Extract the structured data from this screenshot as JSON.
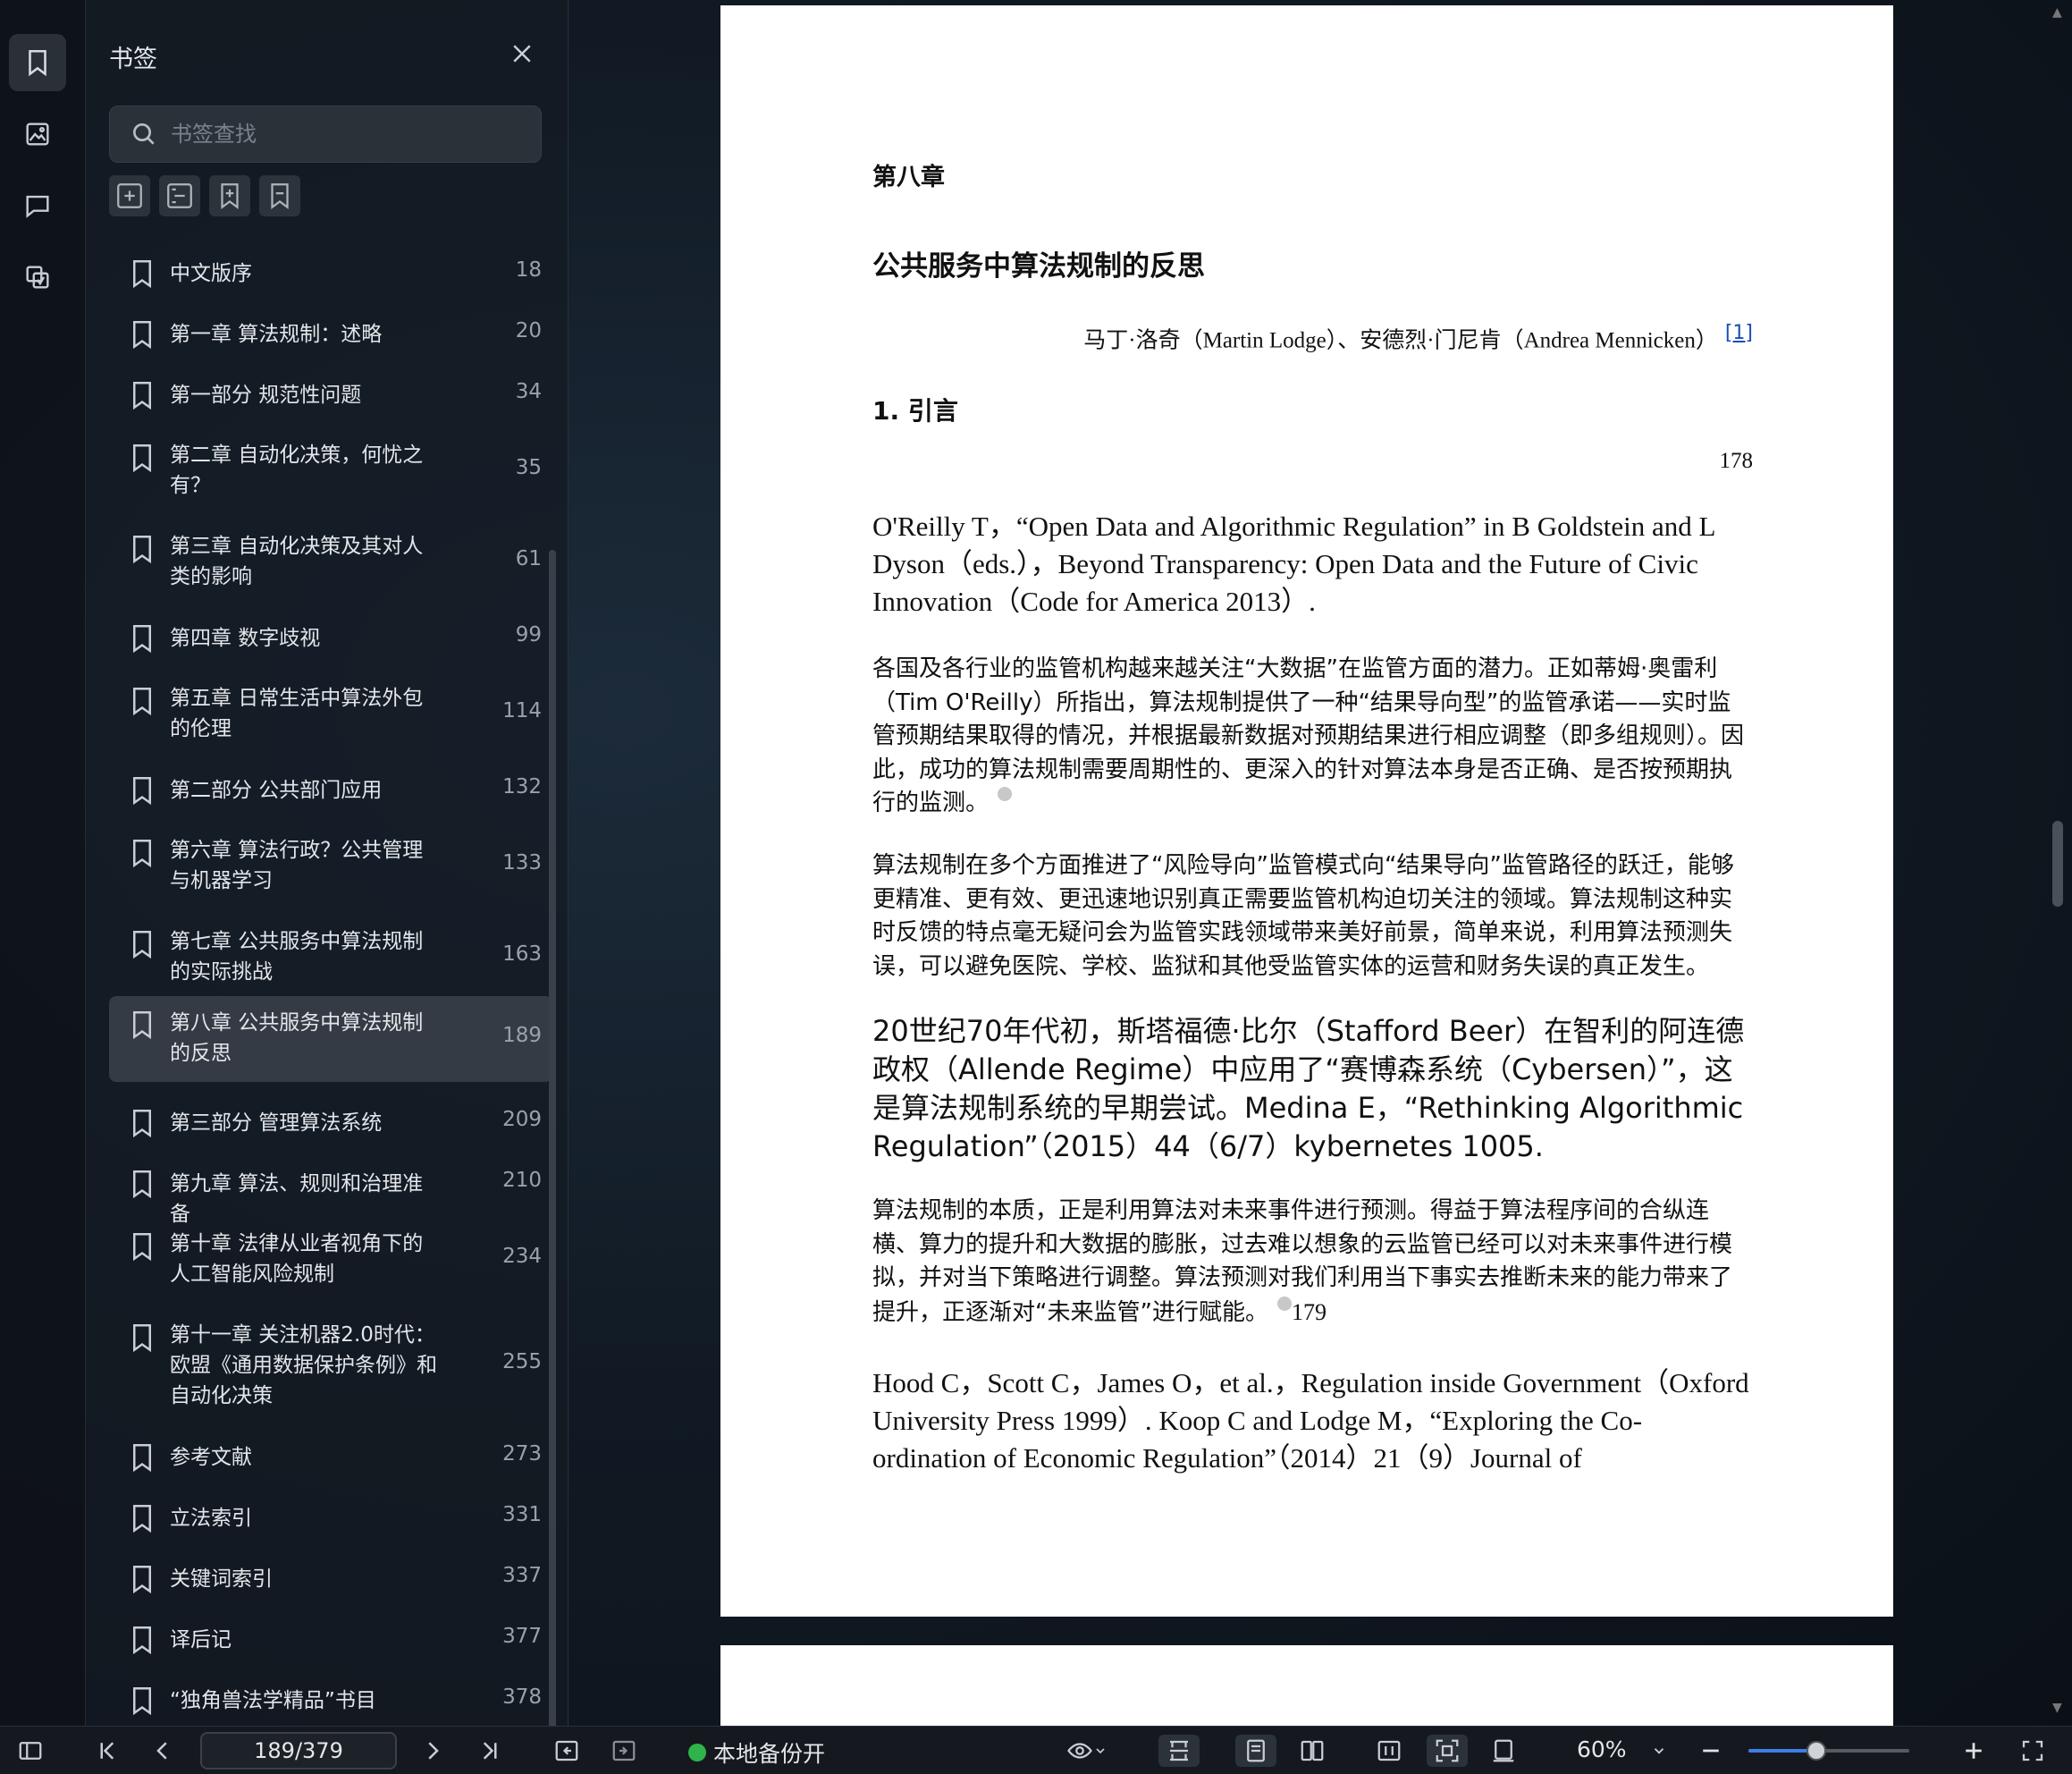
{
  "panel": {
    "title": "书签",
    "search_placeholder": "书签查找"
  },
  "bookmarks": [
    {
      "label": "中文版序",
      "page": "18"
    },
    {
      "label": "第一章 算法规制：述略",
      "page": "20"
    },
    {
      "label": "第一部分 规范性问题",
      "page": "34"
    },
    {
      "label": "第二章 自动化决策，何忧之有？",
      "page": "35"
    },
    {
      "label": "第三章 自动化决策及其对人类的影响",
      "page": "61"
    },
    {
      "label": "第四章 数字歧视",
      "page": "99"
    },
    {
      "label": "第五章 日常生活中算法外包的伦理",
      "page": "114"
    },
    {
      "label": "第二部分 公共部门应用",
      "page": "132"
    },
    {
      "label": "第六章 算法行政？公共管理与机器学习",
      "page": "133"
    },
    {
      "label": "第七章 公共服务中算法规制的实际挑战",
      "page": "163"
    },
    {
      "label": "第八章 公共服务中算法规制的反思",
      "page": "189"
    },
    {
      "label": "第三部分 管理算法系统",
      "page": "209"
    },
    {
      "label": "第九章 算法、规则和治理准备",
      "page": "210"
    },
    {
      "label": "第十章 法律从业者视角下的人工智能风险规制",
      "page": "234"
    },
    {
      "label": "第十一章 关注机器2.0时代：欧盟《通用数据保护条例》和自动化决策",
      "page": "255"
    },
    {
      "label": "参考文献",
      "page": "273"
    },
    {
      "label": "立法索引",
      "page": "331"
    },
    {
      "label": "关键词索引",
      "page": "337"
    },
    {
      "label": "译后记",
      "page": "377"
    },
    {
      "label": "“独角兽法学精品”书目",
      "page": "378"
    }
  ],
  "selected_bookmark": "第八章 公共服务中算法规制的反思",
  "document": {
    "chapter": "第八章",
    "chapter_title": "公共服务中算法规制的反思",
    "author": "马丁·洛奇（Martin Lodge）、安德烈·门尼肯（Andrea Mennicken）",
    "author_note": "[1]",
    "section": "1. 引言",
    "page_number": "178",
    "ref1": "O'Reilly T，“Open Data and Algorithmic Regulation” in B Goldstein and L Dyson（eds.），Beyond Transparency: Open Data and the Future of Civic Innovation（Code for America 2013）.",
    "para1": "各国及各行业的监管机构越来越关注“大数据”在监管方面的潜力。正如蒂姆·奥雷利（Tim O'Reilly）所指出，算法规制提供了一种“结果导向型”的监管承诺——实时监管预期结果取得的情况，并根据最新数据对预期结果进行相应调整（即多组规则）。因此，成功的算法规制需要周期性的、更深入的针对算法本身是否正确、是否按预期执行的监测。",
    "para2": "算法规制在多个方面推进了“风险导向”监管模式向“结果导向”监管路径的跃迁，能够更精准、更有效、更迅速地识别真正需要监管机构迫切关注的领域。算法规制这种实时反馈的特点毫无疑问会为监管实践领域带来美好前景，简单来说，利用算法预测失误，可以避免医院、学校、监狱和其他受监管实体的运营和财务失误的真正发生。",
    "para3": "20世纪70年代初，斯塔福德·比尔（Stafford Beer）在智利的阿连德政权（Allende Regime）中应用了“赛博森系统（Cybersen）”，这是算法规制系统的早期尝试。Medina E，“Rethinking Algorithmic Regulation”（2015）44（6/7）kybernetes 1005.",
    "para4": "算法规制的本质，正是利用算法对未来事件进行预测。得益于算法程序间的合纵连横、算力的提升和大数据的膨胀，过去难以想象的云监管已经可以对未来事件进行模拟，并对当下策略进行调整。算法预测对我们利用当下事实去推断未来的能力带来了提升，正逐渐对“未来监管”进行赋能。",
    "para4_pagenum": "179",
    "ref2": "Hood C，Scott C，James O，et al.，Regulation inside Government（Oxford University Press 1999）. Koop C and Lodge M，“Exploring the Co-ordination of Economic Regulation”（2014）21（9）Journal of"
  },
  "statusbar": {
    "page_field": "189/379",
    "backup_label": "本地备份开",
    "zoom": "60%",
    "zoom_fraction": 0.6
  }
}
